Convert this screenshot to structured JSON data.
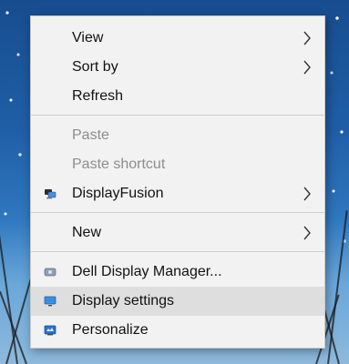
{
  "menu": {
    "items": [
      {
        "label": "View",
        "has_submenu": true
      },
      {
        "label": "Sort by",
        "has_submenu": true
      },
      {
        "label": "Refresh",
        "has_submenu": false
      },
      {
        "label": "Paste",
        "has_submenu": false,
        "disabled": true
      },
      {
        "label": "Paste shortcut",
        "has_submenu": false,
        "disabled": true
      },
      {
        "label": "DisplayFusion",
        "has_submenu": true,
        "icon": "displayfusion-icon"
      },
      {
        "label": "New",
        "has_submenu": true
      },
      {
        "label": "Dell Display Manager...",
        "has_submenu": false,
        "icon": "dell-display-manager-icon"
      },
      {
        "label": "Display settings",
        "has_submenu": false,
        "icon": "display-settings-icon",
        "highlighted": true
      },
      {
        "label": "Personalize",
        "has_submenu": false,
        "icon": "personalize-icon"
      }
    ]
  },
  "colors": {
    "menu_background": "#f2f2f2",
    "highlight": "#dedede",
    "disabled_text": "#8d8d8d",
    "accent_blue": "#2a7fd4"
  }
}
